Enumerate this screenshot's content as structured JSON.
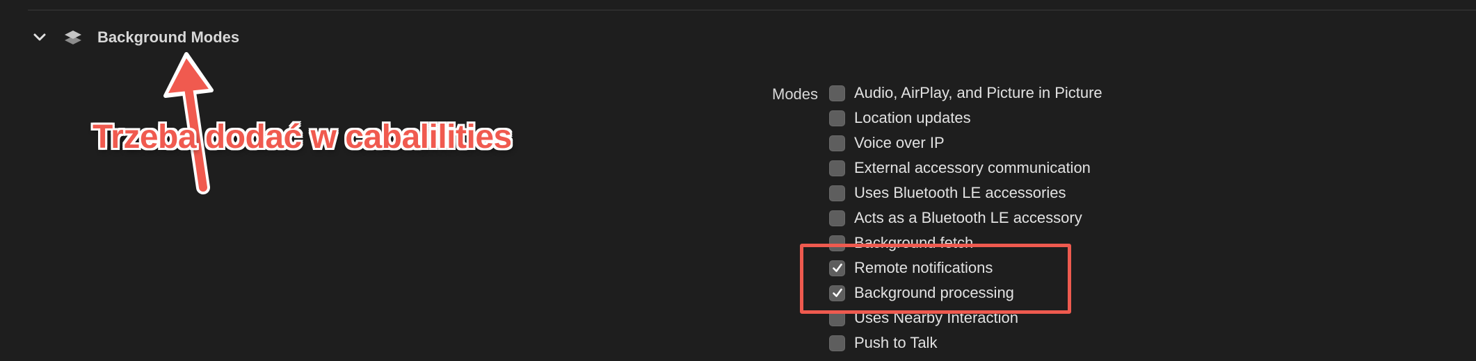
{
  "section": {
    "title": "Background Modes",
    "expanded": true
  },
  "modes": {
    "label": "Modes",
    "options": [
      {
        "label": "Audio, AirPlay, and Picture in Picture",
        "checked": false
      },
      {
        "label": "Location updates",
        "checked": false
      },
      {
        "label": "Voice over IP",
        "checked": false
      },
      {
        "label": "External accessory communication",
        "checked": false
      },
      {
        "label": "Uses Bluetooth LE accessories",
        "checked": false
      },
      {
        "label": "Acts as a Bluetooth LE accessory",
        "checked": false
      },
      {
        "label": "Background fetch",
        "checked": false
      },
      {
        "label": "Remote notifications",
        "checked": true
      },
      {
        "label": "Background processing",
        "checked": true
      },
      {
        "label": "Uses Nearby Interaction",
        "checked": false
      },
      {
        "label": "Push to Talk",
        "checked": false
      }
    ]
  },
  "annotation": {
    "text": "Trzeba dodać w cabalilities",
    "color": "#f05a4f",
    "highlight_color": "#ee5a4f"
  }
}
